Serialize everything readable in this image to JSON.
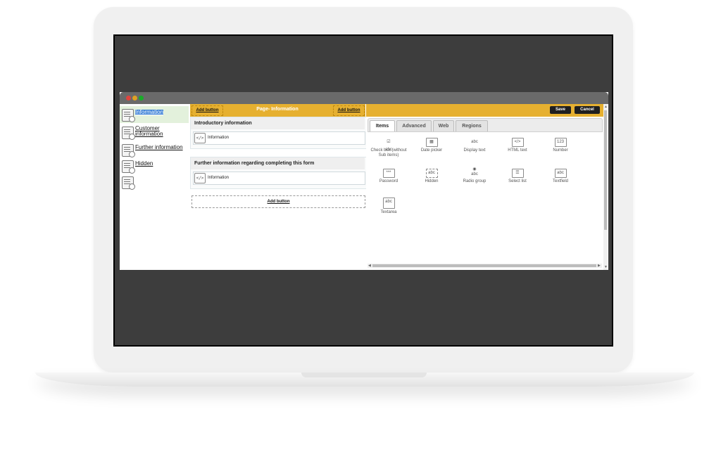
{
  "nav": {
    "items": [
      {
        "label": "Information"
      },
      {
        "label": "Customer information"
      },
      {
        "label": "Further information"
      },
      {
        "label": "Hidden"
      },
      {
        "label": ""
      }
    ]
  },
  "page": {
    "title": "Page- Information",
    "add_left": "Add button",
    "add_right": "Add button",
    "sections": [
      {
        "title": "Introductory information",
        "item": "Information"
      },
      {
        "title": "Further information regarding completing this form",
        "item": "Information"
      }
    ],
    "add_bottom": "Add button"
  },
  "toolbar": {
    "save": "Save",
    "cancel": "Cancel"
  },
  "tabs": [
    "Items",
    "Advanced",
    "Web",
    "Regions"
  ],
  "tools": [
    {
      "icon": "checkbox-icon",
      "glyph": "☑ abc",
      "label": "Check box (without Sub items)"
    },
    {
      "icon": "date-picker-icon",
      "glyph": "▦",
      "label": "Date picker"
    },
    {
      "icon": "display-text-icon",
      "glyph": "abc",
      "label": "Display text"
    },
    {
      "icon": "html-text-icon",
      "glyph": "</>",
      "label": "HTML text"
    },
    {
      "icon": "number-icon",
      "glyph": "123",
      "label": "Number"
    },
    {
      "icon": "password-icon",
      "glyph": "***",
      "label": "Password"
    },
    {
      "icon": "hidden-icon",
      "glyph": "abc",
      "label": "Hidden"
    },
    {
      "icon": "radio-group-icon",
      "glyph": "◉ abc",
      "label": "Radio group"
    },
    {
      "icon": "select-list-icon",
      "glyph": "☰",
      "label": "Select list"
    },
    {
      "icon": "textfield-icon",
      "glyph": "abc",
      "label": "Textfield"
    },
    {
      "icon": "textarea-icon",
      "glyph": "abc",
      "label": "Textarea"
    }
  ],
  "colors": {
    "accent": "#e6b030",
    "active_nav": "#e3f1dc",
    "selection": "#3a7fd6"
  }
}
